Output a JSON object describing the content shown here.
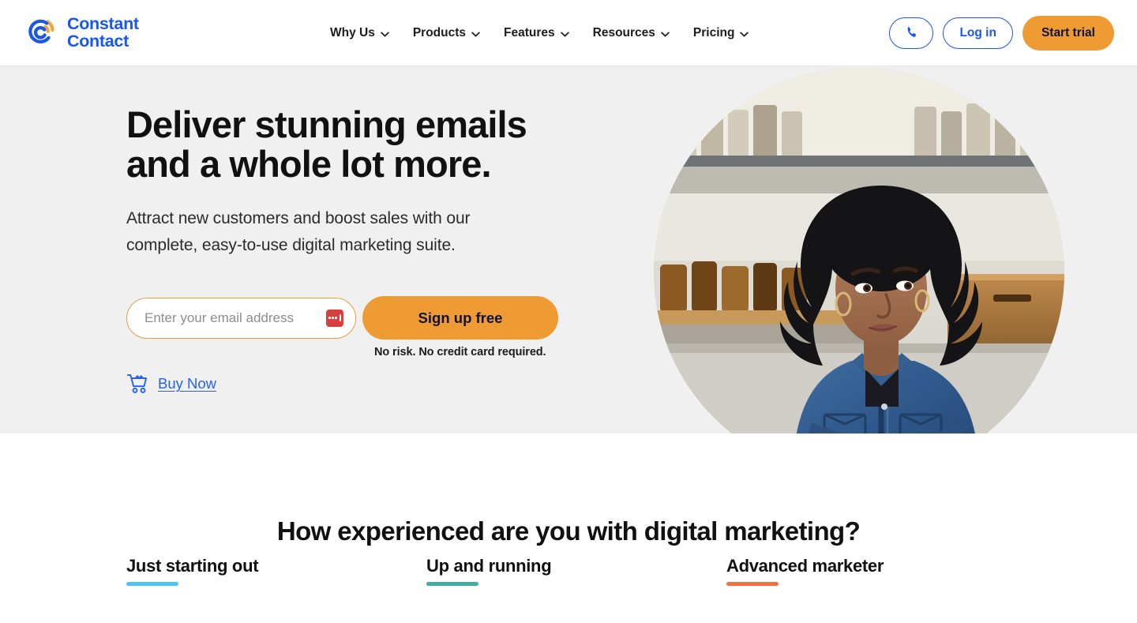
{
  "header": {
    "brand": {
      "name": "Constant\nContact",
      "logo_icon": "constant-contact-circle-logo",
      "logo_blue": "#1856ED",
      "logo_orange": "#F5A139"
    },
    "nav": [
      {
        "label": "Why Us",
        "icon": "chevron-down-icon"
      },
      {
        "label": "Products",
        "icon": "chevron-down-icon"
      },
      {
        "label": "Features",
        "icon": "chevron-down-icon"
      },
      {
        "label": "Resources",
        "icon": "chevron-down-icon"
      },
      {
        "label": "Pricing",
        "icon": "chevron-down-icon"
      }
    ],
    "actions": {
      "phone_icon": "phone-icon",
      "login_label": "Log in",
      "trial_label": "Start trial",
      "accent_blue": "#1856ED",
      "accent_orange": "#EE9B33"
    }
  },
  "hero": {
    "title": "Deliver stunning emails\nand a whole lot more.",
    "subtitle": "Attract new customers and boost sales with our\ncomplete, easy-to-use digital marketing suite.",
    "email_placeholder": "Enter your email address",
    "email_value": "",
    "password_manager_icon": "password-manager-icon",
    "signup_label": "Sign up free",
    "disclaimer": "No risk. No credit card required.",
    "buy_now_label": "Buy Now",
    "cart_icon": "shopping-cart-icon",
    "background_color": "#f0f0f0",
    "photo_alt": "Woman in denim shirt leaning on counter in a shop"
  },
  "experience": {
    "heading": "How experienced are you with digital marketing?",
    "columns": [
      {
        "title": "Just starting out",
        "underline_color": "#4DC4F2"
      },
      {
        "title": "Up and running",
        "underline_color": "#3FAE9F"
      },
      {
        "title": "Advanced marketer",
        "underline_color": "#EE7244"
      }
    ]
  }
}
